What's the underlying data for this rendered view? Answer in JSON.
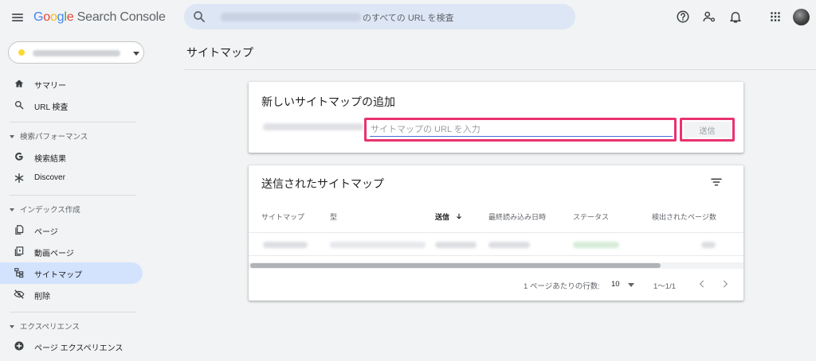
{
  "header": {
    "logo_letters": [
      "G",
      "o",
      "o",
      "g",
      "l",
      "e"
    ],
    "logo_rest": " Search Console",
    "search_text": "のすべての URL を検査"
  },
  "sidebar": {
    "items": [
      {
        "label": "サマリー",
        "icon": "home-icon"
      },
      {
        "label": "URL 検査",
        "icon": "search-icon"
      },
      {
        "label": "検索結果",
        "icon": "google-g-icon"
      },
      {
        "label": "Discover",
        "icon": "asterisk-icon"
      },
      {
        "label": "ページ",
        "icon": "pages-icon"
      },
      {
        "label": "動画ページ",
        "icon": "video-page-icon"
      },
      {
        "label": "サイトマップ",
        "icon": "sitemap-icon",
        "active": true
      },
      {
        "label": "削除",
        "icon": "removal-icon"
      },
      {
        "label": "ページ エクスペリエンス",
        "icon": "plus-circle-icon"
      }
    ],
    "sections": {
      "performance": "検索パフォーマンス",
      "index": "インデックス作成",
      "experience": "エクスペリエンス"
    }
  },
  "page": {
    "title": "サイトマップ"
  },
  "add_sitemap": {
    "title": "新しいサイトマップの追加",
    "input_placeholder": "サイトマップの URL を入力",
    "input_value": "",
    "submit_label": "送信"
  },
  "submitted": {
    "title": "送信されたサイトマップ",
    "columns": [
      "サイトマップ",
      "型",
      "送信",
      "最終読み込み日時",
      "ステータス",
      "検出されたページ数"
    ],
    "sorted_column": "送信",
    "sort_direction": "descending",
    "rows_per_page_label": "1 ページあたりの行数:",
    "rows_per_page": "10",
    "range": "1〜1/1"
  },
  "colors": {
    "accent_highlight": "#e8336f",
    "active_nav": "#d3e3fd",
    "search_bg": "#dde6f5",
    "input_underline": "#4a6bd6"
  }
}
